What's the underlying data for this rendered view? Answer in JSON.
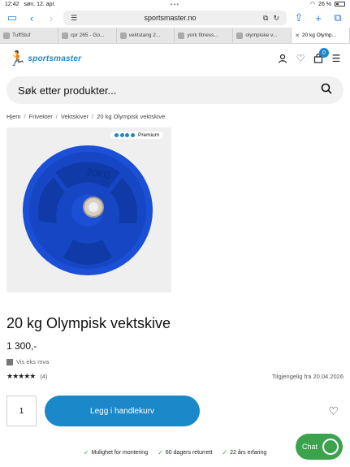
{
  "status_bar": {
    "time": "12:42",
    "date": "søn. 12. apr.",
    "battery": "26 %"
  },
  "browser": {
    "url": "sportsmaster.no",
    "tabs": [
      {
        "label": "TuffStuf"
      },
      {
        "label": "cpr 265 - Go..."
      },
      {
        "label": "vektstang 2..."
      },
      {
        "label": "york fitness..."
      },
      {
        "label": "olympiske v..."
      },
      {
        "label": "20 kg Olymp..."
      }
    ]
  },
  "header": {
    "logo_text": "sportsmaster",
    "cart_count": "0"
  },
  "search": {
    "placeholder": "Søk etter produkter..."
  },
  "breadcrumb": [
    "Hjem",
    "Frivekter",
    "Vektskiver",
    "20 kg Olympisk vektskive"
  ],
  "product": {
    "badge": "Premium",
    "title": "20 kg Olympisk vektskive",
    "price": "1 300,-",
    "vat_label": "Vis eks mva",
    "rating_count": "(4)",
    "availability": "Tilgjengelig fra 20.04.2026",
    "quantity": "1",
    "add_to_cart": "Legg i handlekurv",
    "plate_label": "20KG",
    "plate_color": "#1a4fd6"
  },
  "usps": [
    "Mulighet for montering",
    "60 dagers returrett",
    "22 års erfaring"
  ],
  "chat": {
    "label": "Chat"
  }
}
